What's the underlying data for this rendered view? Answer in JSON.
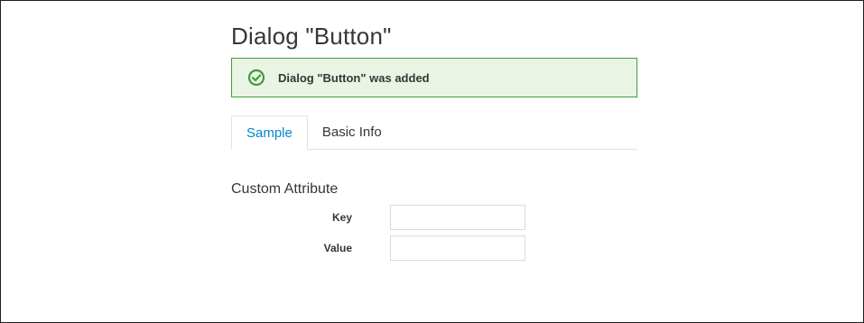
{
  "page": {
    "title": "Dialog \"Button\""
  },
  "alert": {
    "type": "success",
    "icon": "check-circle-icon",
    "message": "Dialog \"Button\" was added",
    "colors": {
      "background": "#e9f4e5",
      "border": "#3f9c35",
      "icon": "#3f9c35"
    }
  },
  "tabs": [
    {
      "label": "Sample",
      "active": true
    },
    {
      "label": "Basic Info",
      "active": false
    }
  ],
  "section": {
    "title": "Custom Attribute"
  },
  "form": {
    "fields": [
      {
        "label": "Key",
        "value": "",
        "placeholder": ""
      },
      {
        "label": "Value",
        "value": "",
        "placeholder": ""
      }
    ]
  },
  "colors": {
    "accent": "#0088ce",
    "text": "#363636"
  }
}
